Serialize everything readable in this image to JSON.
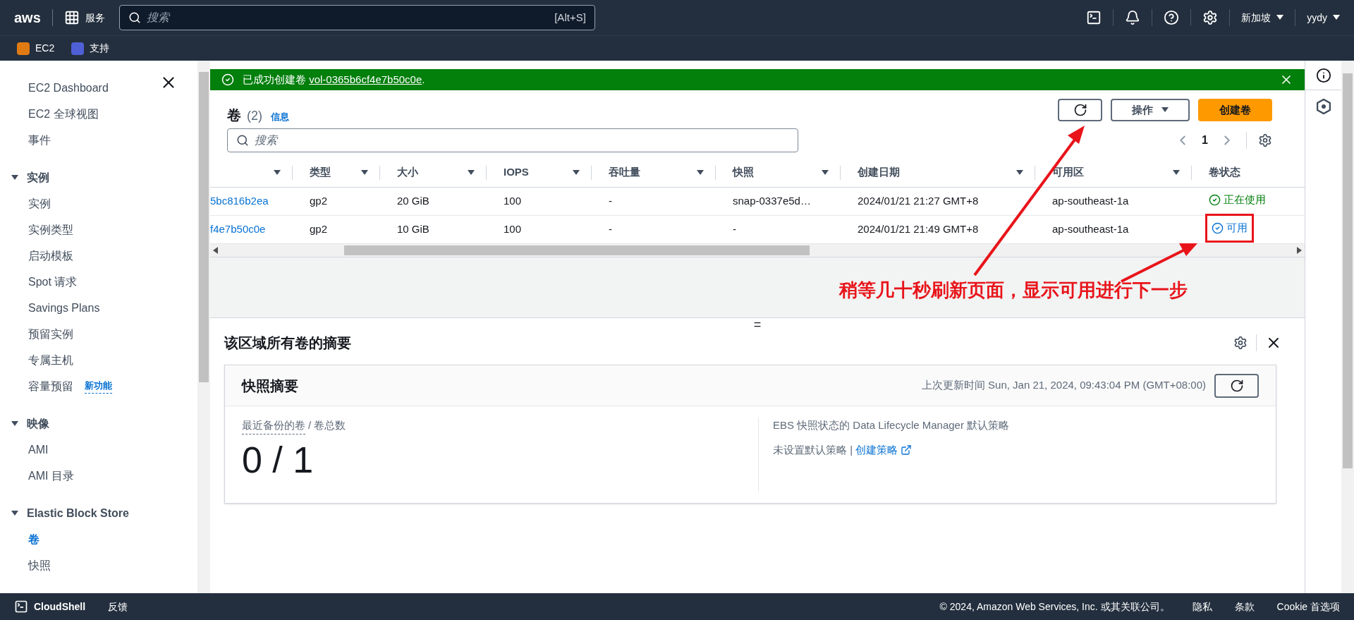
{
  "top_nav": {
    "logo": "aws",
    "services": "服务",
    "search_placeholder": "搜索",
    "search_shortcut": "[Alt+S]",
    "region": "新加坡",
    "user": "yydy"
  },
  "favorites": [
    {
      "label": "EC2",
      "color": "#e07b14"
    },
    {
      "label": "支持",
      "color": "#4f5fd6"
    }
  ],
  "sidebar": {
    "top_items": [
      {
        "label": "EC2 Dashboard",
        "selected": false
      },
      {
        "label": "EC2 全球视图",
        "selected": false
      },
      {
        "label": "事件",
        "selected": false
      }
    ],
    "sections": [
      {
        "title": "实例",
        "expanded": true,
        "items": [
          {
            "label": "实例",
            "selected": false
          },
          {
            "label": "实例类型",
            "selected": false
          },
          {
            "label": "启动模板",
            "selected": false
          },
          {
            "label": "Spot 请求",
            "selected": false
          },
          {
            "label": "Savings Plans",
            "selected": false
          },
          {
            "label": "预留实例",
            "selected": false
          },
          {
            "label": "专属主机",
            "selected": false
          },
          {
            "label": "容量预留",
            "selected": false,
            "badge": "新功能"
          }
        ]
      },
      {
        "title": "映像",
        "expanded": true,
        "items": [
          {
            "label": "AMI",
            "selected": false
          },
          {
            "label": "AMI 目录",
            "selected": false
          }
        ]
      },
      {
        "title": "Elastic Block Store",
        "expanded": true,
        "items": [
          {
            "label": "卷",
            "selected": true
          },
          {
            "label": "快照",
            "selected": false
          }
        ]
      }
    ]
  },
  "flash": {
    "message": "已成功创建卷",
    "link": "vol-0365b6cf4e7b50c0e",
    "suffix": "."
  },
  "volumes": {
    "title": "卷",
    "count": "(2)",
    "info": "信息",
    "actions": "操作",
    "create": "创建卷",
    "search_placeholder": "搜索",
    "page": "1",
    "columns": [
      "",
      "类型",
      "大小",
      "IOPS",
      "吞吐量",
      "快照",
      "创建日期",
      "可用区",
      "卷状态"
    ],
    "rows": [
      {
        "cells": [
          "5bc816b2ea",
          "gp2",
          "20 GiB",
          "100",
          "-",
          "snap-0337e5d…",
          "2024/01/21 21:27 GMT+8",
          "ap-southeast-1a"
        ],
        "status": {
          "kind": "in-use",
          "label": "正在使用"
        }
      },
      {
        "cells": [
          "f4e7b50c0e",
          "gp2",
          "10 GiB",
          "100",
          "-",
          "-",
          "2024/01/21 21:49 GMT+8",
          "ap-southeast-1a"
        ],
        "status": {
          "kind": "available",
          "label": "可用"
        }
      }
    ]
  },
  "annotation": {
    "text": "稍等几十秒刷新页面，显示可用进行下一步"
  },
  "split_panel": {
    "handle": "=",
    "title": "该区域所有卷的摘要",
    "card": {
      "title": "快照摘要",
      "updated": "上次更新时间 Sun, Jan 21, 2024, 09:43:04 PM (GMT+08:00)",
      "metric_label": "最近备份的卷",
      "metric_suffix": "/ 卷总数",
      "metric_value": "0 / 1",
      "policy_title": "EBS 快照状态的 Data Lifecycle Manager 默认策略",
      "policy_text": "未设置默认策略 |",
      "policy_link": "创建策略"
    }
  },
  "footer": {
    "cloudshell": "CloudShell",
    "feedback": "反馈",
    "copyright": "© 2024, Amazon Web Services, Inc. 或其关联公司。",
    "links": [
      "隐私",
      "条款",
      "Cookie 首选项"
    ]
  }
}
